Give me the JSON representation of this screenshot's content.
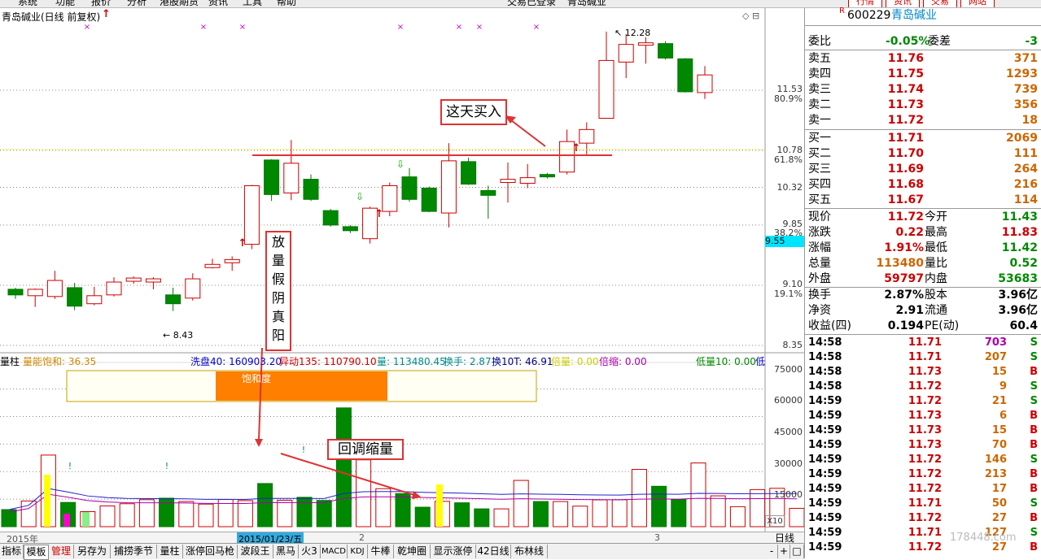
{
  "menu": {
    "items": [
      "系统",
      "功能",
      "报价",
      "分析",
      "港股期货",
      "资讯",
      "工具",
      "帮助"
    ],
    "status": "交易已登录",
    "stock_title": "青岛碱业",
    "right_buttons": [
      "行情",
      "资讯",
      "交易",
      "网站"
    ]
  },
  "chart_header": {
    "title": "青岛碱业(日线 前复权)",
    "high_label": "12.28",
    "low_label": "8.43"
  },
  "price_axis": {
    "labels": [
      {
        "price": "11.53",
        "pct": "80.9%"
      },
      {
        "price": "10.78",
        "pct": "61.8%"
      },
      {
        "price": "10.32",
        "pct": ""
      },
      {
        "price": "9.85",
        "pct": "38.2%"
      },
      {
        "price": "9.10",
        "pct": "19.1%"
      },
      {
        "price": "8.35",
        "pct": ""
      }
    ],
    "current_box": "9.55"
  },
  "volume_axis": {
    "labels": [
      "75000",
      "60000",
      "45000",
      "30000",
      "15000"
    ],
    "multiplier": "X10"
  },
  "indicator_bar": {
    "name": "量柱",
    "items": [
      {
        "text": "量能饱和: 36.35",
        "color": "#cc8800"
      },
      {
        "text": "洗盘40: 160903.20",
        "color": "#0000cc"
      },
      {
        "text": "异动135: 110790.10",
        "color": "#cc0000"
      },
      {
        "text": "量: 113480.45",
        "color": "#008888"
      },
      {
        "text": "换手: 2.87",
        "color": "#008888"
      },
      {
        "text": "换10T: 46.91",
        "color": "#000088"
      },
      {
        "text": "倍量: 0.00",
        "color": "#cccc00"
      },
      {
        "text": "倍缩: 0.00",
        "color": "#aa00aa"
      },
      {
        "text": "低量10: 0.00",
        "color": "#008800"
      },
      {
        "text": "低",
        "color": "#0000cc"
      }
    ],
    "saturation_label": "饱和度"
  },
  "annotations": {
    "buy": "这天买入",
    "fake": [
      "放",
      "量",
      "假",
      "阴",
      "真",
      "阳"
    ],
    "pullback": "回调缩量"
  },
  "date_bar": {
    "year": "2015年",
    "selected": "2015/01/23/五",
    "month2": "2",
    "month3": "3",
    "period": "日线"
  },
  "tabs": [
    "指标",
    "模板",
    "管理",
    "另存为",
    "捕捞季节",
    "量柱",
    "涨停回马枪",
    "波段王",
    "黑马",
    "火3",
    "MACD",
    "KDJ",
    "牛棒",
    "乾坤圈",
    "显示涨停",
    "42日线",
    "布林线"
  ],
  "zoom_buttons": [
    "-",
    "+",
    "□"
  ],
  "quote": {
    "code_prefix": "R",
    "code": "600229",
    "name": "青岛碱业",
    "weibi": {
      "label": "委比",
      "value": "-0.05%",
      "label2": "委差",
      "value2": "-3"
    },
    "asks": [
      {
        "label": "卖五",
        "price": "11.76",
        "vol": "371"
      },
      {
        "label": "卖四",
        "price": "11.75",
        "vol": "1293"
      },
      {
        "label": "卖三",
        "price": "11.74",
        "vol": "739"
      },
      {
        "label": "卖二",
        "price": "11.73",
        "vol": "356"
      },
      {
        "label": "卖一",
        "price": "11.72",
        "vol": "18"
      }
    ],
    "bids": [
      {
        "label": "买一",
        "price": "11.71",
        "vol": "2069"
      },
      {
        "label": "买二",
        "price": "11.70",
        "vol": "111"
      },
      {
        "label": "买三",
        "price": "11.69",
        "vol": "264"
      },
      {
        "label": "买四",
        "price": "11.68",
        "vol": "216"
      },
      {
        "label": "买五",
        "price": "11.67",
        "vol": "114"
      }
    ],
    "stats": [
      {
        "l1": "现价",
        "v1": "11.72",
        "c1": "#cc0000",
        "l2": "今开",
        "v2": "11.43",
        "c2": "#008800"
      },
      {
        "l1": "涨跌",
        "v1": "0.22",
        "c1": "#cc0000",
        "l2": "最高",
        "v2": "11.83",
        "c2": "#cc0000"
      },
      {
        "l1": "涨幅",
        "v1": "1.91%",
        "c1": "#cc0000",
        "l2": "最低",
        "v2": "11.42",
        "c2": "#008800"
      },
      {
        "l1": "总量",
        "v1": "113480",
        "c1": "#cc6600",
        "l2": "量比",
        "v2": "0.52",
        "c2": "#008800"
      },
      {
        "l1": "外盘",
        "v1": "59797",
        "c1": "#cc0000",
        "l2": "内盘",
        "v2": "53683",
        "c2": "#008800"
      }
    ],
    "stats2": [
      {
        "l1": "换手",
        "v1": "2.87%",
        "l2": "股本",
        "v2": "3.96亿"
      },
      {
        "l1": "净资",
        "v1": "2.91",
        "l2": "流通",
        "v2": "3.96亿"
      },
      {
        "l1": "收益(四)",
        "v1": "0.194",
        "l2": "PE(动)",
        "v2": "60.4"
      }
    ],
    "trades": [
      {
        "t": "14:58",
        "p": "11.71",
        "v": "703",
        "s": "S",
        "vc": "#aa00aa"
      },
      {
        "t": "14:58",
        "p": "11.71",
        "v": "207",
        "s": "S",
        "vc": "#cc6600"
      },
      {
        "t": "14:58",
        "p": "11.73",
        "v": "15",
        "s": "B",
        "vc": "#cc6600"
      },
      {
        "t": "14:58",
        "p": "11.72",
        "v": "9",
        "s": "S",
        "vc": "#cc6600"
      },
      {
        "t": "14:59",
        "p": "11.72",
        "v": "21",
        "s": "S",
        "vc": "#cc6600"
      },
      {
        "t": "14:59",
        "p": "11.73",
        "v": "6",
        "s": "B",
        "vc": "#cc6600"
      },
      {
        "t": "14:59",
        "p": "11.73",
        "v": "15",
        "s": "B",
        "vc": "#cc6600"
      },
      {
        "t": "14:59",
        "p": "11.73",
        "v": "70",
        "s": "B",
        "vc": "#cc6600"
      },
      {
        "t": "14:59",
        "p": "11.72",
        "v": "146",
        "s": "S",
        "vc": "#cc6600"
      },
      {
        "t": "14:59",
        "p": "11.72",
        "v": "213",
        "s": "B",
        "vc": "#cc6600"
      },
      {
        "t": "14:59",
        "p": "11.72",
        "v": "17",
        "s": "B",
        "vc": "#cc6600"
      },
      {
        "t": "14:59",
        "p": "11.71",
        "v": "50",
        "s": "S",
        "vc": "#cc6600"
      },
      {
        "t": "14:59",
        "p": "11.72",
        "v": "27",
        "s": "B",
        "vc": "#cc6600"
      },
      {
        "t": "14:59",
        "p": "11.71",
        "v": "127",
        "s": "S",
        "vc": "#cc6600"
      },
      {
        "t": "14:59",
        "p": "11.72",
        "v": "27",
        "s": "B",
        "vc": "#cc6600"
      }
    ],
    "watermark": "178448.com"
  },
  "chart_data": {
    "type": "candlestick",
    "candles": [
      {
        "o": 9.05,
        "c": 8.98,
        "h": 9.07,
        "l": 8.93
      },
      {
        "o": 8.97,
        "c": 9.05,
        "h": 9.06,
        "l": 8.83
      },
      {
        "o": 8.96,
        "c": 9.16,
        "h": 9.28,
        "l": 8.93
      },
      {
        "o": 9.07,
        "c": 8.84,
        "h": 9.13,
        "l": 8.79
      },
      {
        "o": 8.87,
        "c": 8.97,
        "h": 9.08,
        "l": 8.85
      },
      {
        "o": 8.98,
        "c": 9.14,
        "h": 9.2,
        "l": 8.96
      },
      {
        "o": 9.15,
        "c": 9.19,
        "h": 9.21,
        "l": 9.12
      },
      {
        "o": 9.14,
        "c": 9.18,
        "h": 9.2,
        "l": 9.05
      },
      {
        "o": 8.98,
        "c": 8.87,
        "h": 9.07,
        "l": 8.78
      },
      {
        "o": 8.94,
        "c": 9.18,
        "h": 9.25,
        "l": 8.91
      },
      {
        "o": 9.32,
        "c": 9.36,
        "h": 9.43,
        "l": 9.31
      },
      {
        "o": 9.38,
        "c": 9.42,
        "h": 9.46,
        "l": 9.28
      },
      {
        "o": 9.61,
        "c": 10.34,
        "h": 10.35,
        "l": 9.55
      },
      {
        "o": 10.66,
        "c": 10.23,
        "h": 10.67,
        "l": 10.15
      },
      {
        "o": 10.25,
        "c": 10.62,
        "h": 10.91,
        "l": 10.16
      },
      {
        "o": 10.42,
        "c": 10.17,
        "h": 10.48,
        "l": 10.15
      },
      {
        "o": 10.03,
        "c": 9.85,
        "h": 10.05,
        "l": 9.83
      },
      {
        "o": 9.83,
        "c": 9.78,
        "h": 9.85,
        "l": 9.75
      },
      {
        "o": 9.68,
        "c": 10.06,
        "h": 10.08,
        "l": 9.62
      },
      {
        "o": 10.02,
        "c": 10.34,
        "h": 10.38,
        "l": 9.96
      },
      {
        "o": 10.45,
        "c": 10.17,
        "h": 10.56,
        "l": 10.14
      },
      {
        "o": 10.31,
        "c": 10.02,
        "h": 10.33,
        "l": 10.01
      },
      {
        "o": 10.0,
        "c": 10.65,
        "h": 10.87,
        "l": 9.82
      },
      {
        "o": 10.64,
        "c": 10.36,
        "h": 10.69,
        "l": 10.35
      },
      {
        "o": 10.28,
        "c": 10.22,
        "h": 10.34,
        "l": 9.93
      },
      {
        "o": 10.38,
        "c": 10.42,
        "h": 10.63,
        "l": 10.13
      },
      {
        "o": 10.37,
        "c": 10.44,
        "h": 10.61,
        "l": 10.31
      },
      {
        "o": 10.48,
        "c": 10.45,
        "h": 10.5,
        "l": 10.43
      },
      {
        "o": 10.51,
        "c": 10.89,
        "h": 11.04,
        "l": 10.48
      },
      {
        "o": 10.87,
        "c": 11.04,
        "h": 11.13,
        "l": 10.73
      },
      {
        "o": 11.18,
        "c": 11.9,
        "h": 12.26,
        "l": 11.18
      },
      {
        "o": 11.88,
        "c": 12.1,
        "h": 12.23,
        "l": 11.68
      },
      {
        "o": 12.09,
        "c": 12.12,
        "h": 12.19,
        "l": 11.86
      },
      {
        "o": 12.11,
        "c": 11.93,
        "h": 12.14,
        "l": 11.91
      },
      {
        "o": 11.92,
        "c": 11.51,
        "h": 11.93,
        "l": 11.5
      },
      {
        "o": 11.5,
        "c": 11.72,
        "h": 11.83,
        "l": 11.42
      }
    ],
    "volumes": [
      9300,
      14000,
      39000,
      13200,
      8200,
      11300,
      12500,
      14700,
      15500,
      13700,
      12300,
      14800,
      14200,
      23500,
      14400,
      16000,
      14300,
      64700,
      36400,
      20700,
      18000,
      10600,
      13800,
      13000,
      9700,
      9700,
      25200,
      13700,
      13700,
      11200,
      14600,
      14700,
      31200,
      22000,
      14800,
      34700,
      16800,
      10900,
      20200,
      20900,
      10000
    ],
    "price_ylim": [
      8.3,
      12.4
    ],
    "volume_ylim": [
      0,
      85000
    ]
  }
}
